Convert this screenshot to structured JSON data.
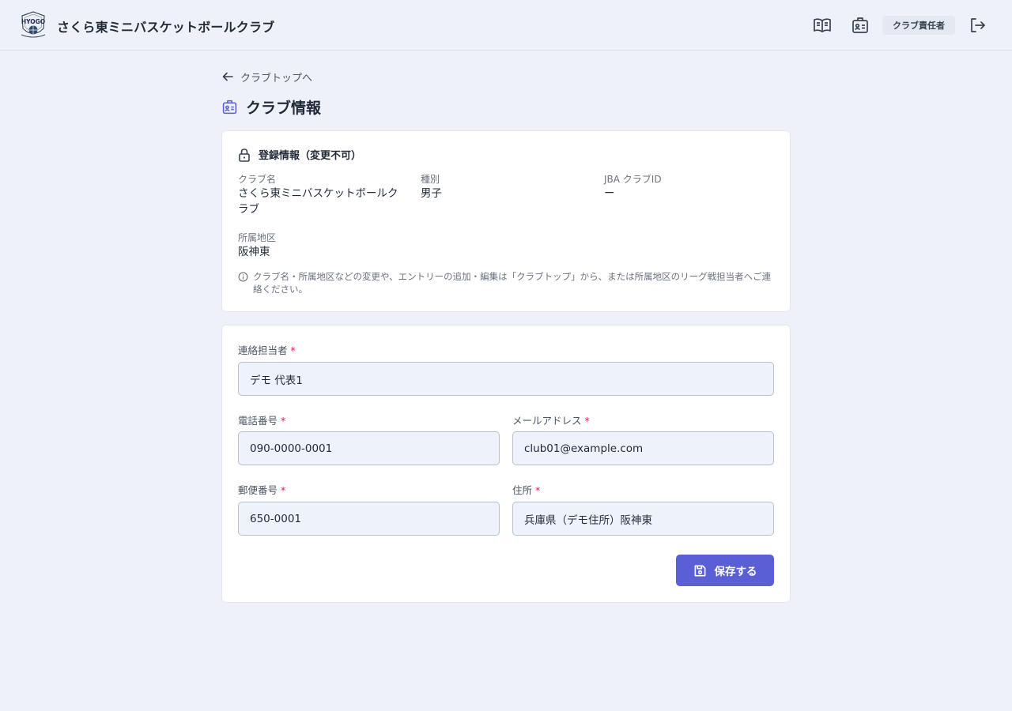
{
  "header": {
    "app_title": "さくら東ミニバスケットボールクラブ",
    "logo_text": "HYOGO",
    "role_badge": "クラブ責任者",
    "icons": [
      "book-icon",
      "id-card-icon",
      "logout-icon"
    ]
  },
  "nav": {
    "back_label": "クラブトップへ"
  },
  "page": {
    "title": "クラブ情報",
    "title_icon": "id-card-icon"
  },
  "registration": {
    "section_title": "登録情報（変更不可）",
    "club_name_label": "クラブ名",
    "club_name_value": "さくら東ミニバスケットボールクラブ",
    "category_label": "種別",
    "category_value": "男子",
    "jba_id_label": "JBA クラブID",
    "jba_id_value": "ー",
    "district_label": "所属地区",
    "district_value": "阪神東",
    "note": "クラブ名・所属地区などの変更や、エントリーの追加・編集は「クラブトップ」から、または所属地区のリーグ戦担当者へご連絡ください。"
  },
  "form": {
    "contact_label": "連絡担当者",
    "contact_value": "デモ 代表1",
    "phone_label": "電話番号",
    "phone_value": "090-0000-0001",
    "email_label": "メールアドレス",
    "email_value": "club01@example.com",
    "postal_label": "郵便番号",
    "postal_value": "650-0001",
    "address_label": "住所",
    "address_value": "兵庫県（デモ住所）阪神東",
    "required_mark": "*",
    "save_label": "保存する"
  },
  "colors": {
    "background": "#eef1f8",
    "accent": "#5b5fd6",
    "required": "#e11d48",
    "input_bg": "#eef2fa"
  }
}
